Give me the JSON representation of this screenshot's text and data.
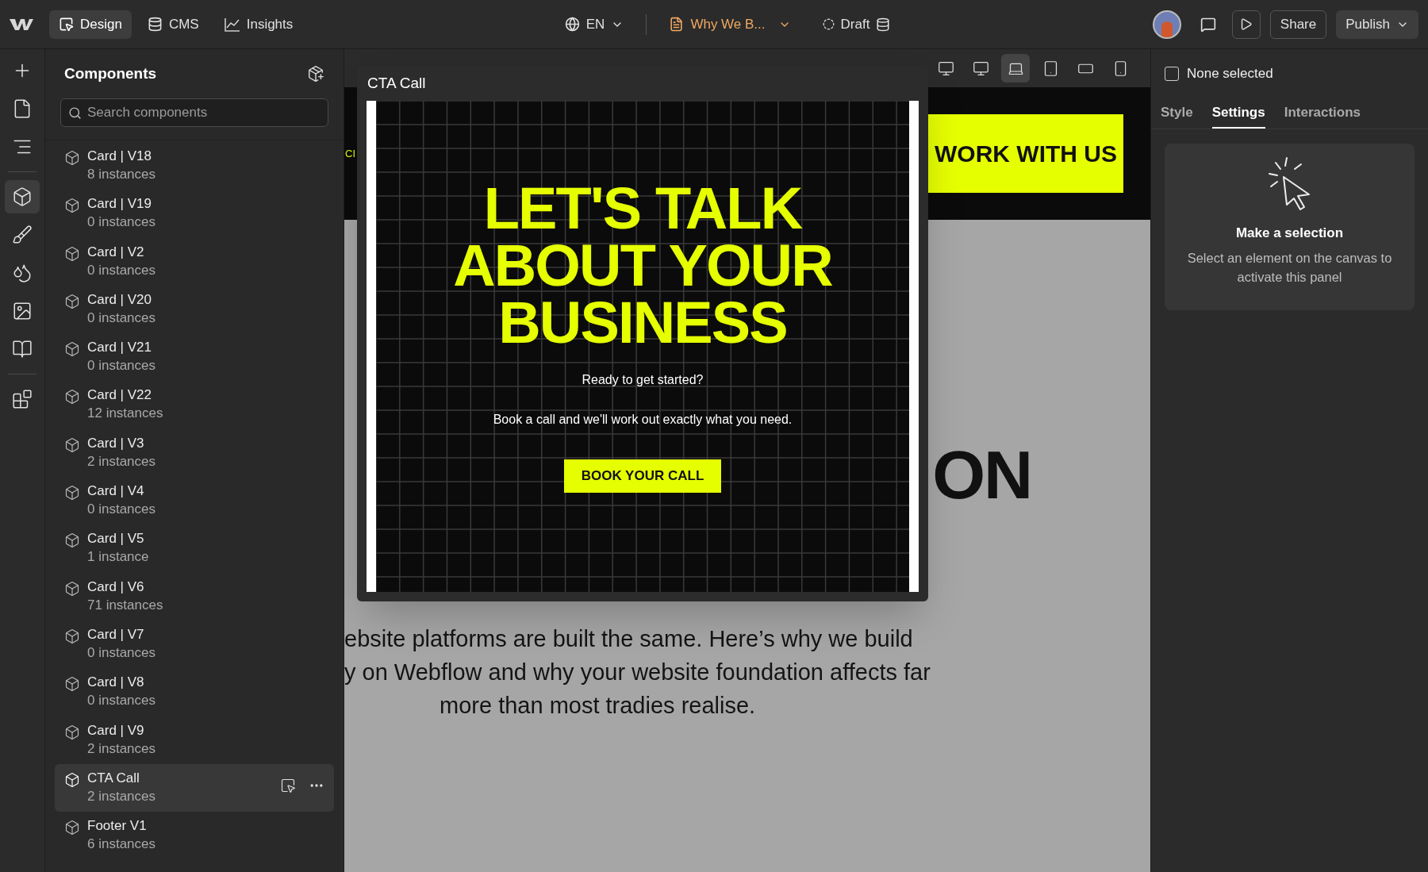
{
  "topbar": {
    "nav": [
      {
        "label": "Design",
        "selected": true
      },
      {
        "label": "CMS",
        "selected": false
      },
      {
        "label": "Insights",
        "selected": false
      }
    ],
    "locale": "EN",
    "page": "Why We B...",
    "status": "Draft",
    "share": "Share",
    "publish": "Publish"
  },
  "rail": [
    {
      "kind": "add",
      "selected": false
    },
    {
      "kind": "pages",
      "selected": false
    },
    {
      "kind": "navigator",
      "selected": false
    },
    {
      "kind": "components",
      "selected": true
    },
    {
      "kind": "styles",
      "selected": false
    },
    {
      "kind": "variables",
      "selected": false
    },
    {
      "kind": "assets",
      "selected": false
    },
    {
      "kind": "library",
      "selected": false
    },
    {
      "kind": "apps",
      "selected": false
    }
  ],
  "components_panel": {
    "title": "Components",
    "search": {
      "placeholder": "Search components"
    },
    "items": [
      {
        "name": "Card | V18",
        "count": "8 instances",
        "selected": false
      },
      {
        "name": "Card | V19",
        "count": "0 instances",
        "selected": false
      },
      {
        "name": "Card | V2",
        "count": "0 instances",
        "selected": false
      },
      {
        "name": "Card | V20",
        "count": "0 instances",
        "selected": false
      },
      {
        "name": "Card | V21",
        "count": "0 instances",
        "selected": false
      },
      {
        "name": "Card | V22",
        "count": "12 instances",
        "selected": false
      },
      {
        "name": "Card | V3",
        "count": "2 instances",
        "selected": false
      },
      {
        "name": "Card | V4",
        "count": "0 instances",
        "selected": false
      },
      {
        "name": "Card | V5",
        "count": "1 instance",
        "selected": false
      },
      {
        "name": "Card | V6",
        "count": "71 instances",
        "selected": false
      },
      {
        "name": "Card | V7",
        "count": "0 instances",
        "selected": false
      },
      {
        "name": "Card | V8",
        "count": "0 instances",
        "selected": false
      },
      {
        "name": "Card | V9",
        "count": "2 instances",
        "selected": false
      },
      {
        "name": "CTA Call",
        "count": "2 instances",
        "selected": true
      },
      {
        "name": "Footer V1",
        "count": "6 instances",
        "selected": false
      }
    ]
  },
  "breakpoints": [
    {
      "kind": "desktop",
      "selected": false
    },
    {
      "kind": "desktop",
      "selected": false
    },
    {
      "kind": "laptop",
      "selected": true
    },
    {
      "kind": "tablet",
      "selected": false
    },
    {
      "kind": "landscape",
      "selected": false
    },
    {
      "kind": "phone",
      "selected": false
    }
  ],
  "canvas": {
    "header_text": "CI",
    "header_button": "WORK WITH US",
    "heading_fragment": "ON",
    "paragraph_lines": [
      "ebsite platforms are built the same. Here’s why we build",
      "y on Webflow and why your website foundation affects far",
      "more than most tradies realise."
    ]
  },
  "preview": {
    "title": "CTA Call",
    "heading": [
      "LET'S TALK",
      "ABOUT YOUR",
      "BUSINESS"
    ],
    "subheading": "Ready to get started?",
    "text": "Book a call and we'll work out exactly what you need.",
    "button": "BOOK YOUR CALL"
  },
  "right_panel": {
    "selection": {
      "label": "None selected",
      "checked": false
    },
    "tabs": [
      {
        "label": "Style",
        "selected": false
      },
      {
        "label": "Settings",
        "selected": true
      },
      {
        "label": "Interactions",
        "selected": false
      }
    ],
    "empty_title": "Make a selection",
    "empty_text": "Select an element on the canvas to activate this panel"
  }
}
